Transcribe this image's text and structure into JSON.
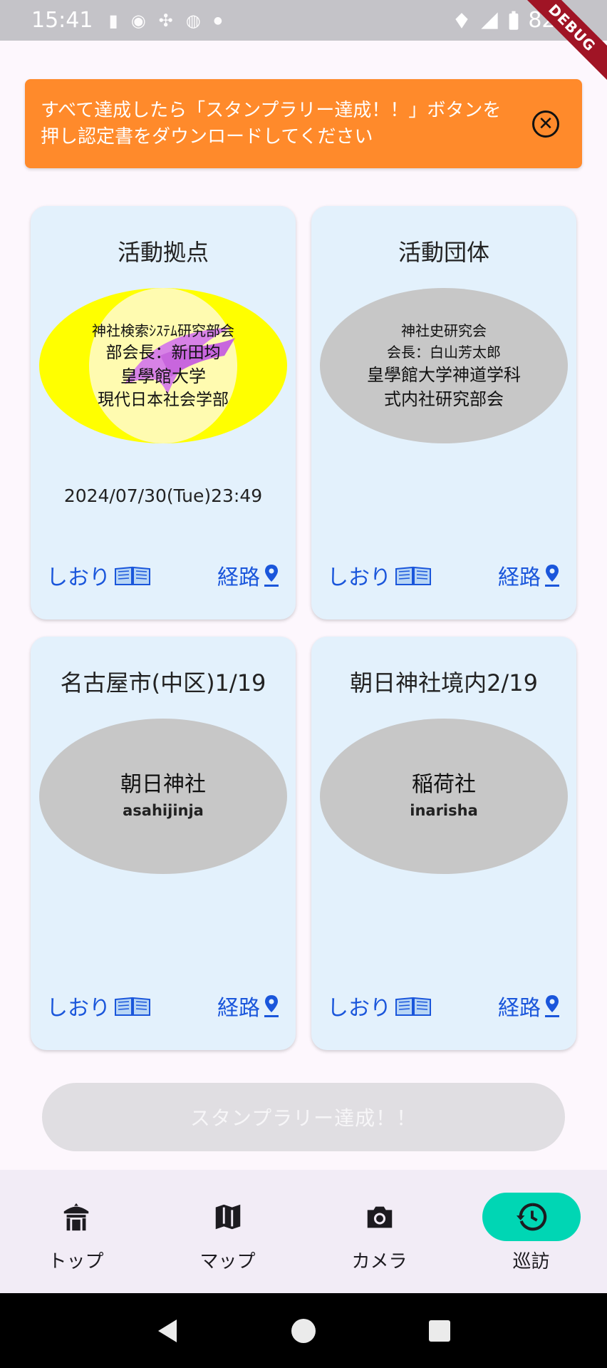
{
  "status_bar": {
    "time": "15:41",
    "battery": "82%",
    "icons_left": [
      "sim-card-icon",
      "messenger-icon",
      "slack-icon",
      "app-icon",
      "dot-icon"
    ],
    "debug_label": "DEBUG"
  },
  "notice": {
    "text": "すべて達成したら「スタンプラリー達成！！」ボタンを押し認定書をダウンロードしてください",
    "color": "#ff8a2b"
  },
  "cards": [
    {
      "title": "活動拠点",
      "earned": true,
      "badge_lines": [
        "神社検索ｼｽﾃﾑ研究部会",
        "部会長：新田均",
        "皇學館大学",
        "現代日本社会学部"
      ],
      "date": "2024/07/30(Tue)23:49",
      "bookmark_label": "しおり",
      "route_label": "経路"
    },
    {
      "title": "活動団体",
      "earned": false,
      "badge_lines": [
        "神社史研究会",
        "会長：白山芳太郎",
        "皇學館大学神道学科",
        "式内社研究部会"
      ],
      "bookmark_label": "しおり",
      "route_label": "経路"
    },
    {
      "title": "名古屋市(中区)1/19",
      "earned": false,
      "badge_name": "朝日神社",
      "badge_roman": "asahijinja",
      "bookmark_label": "しおり",
      "route_label": "経路"
    },
    {
      "title": "朝日神社境内2/19",
      "earned": false,
      "badge_name": "稲荷社",
      "badge_roman": "inarisha",
      "bookmark_label": "しおり",
      "route_label": "経路"
    }
  ],
  "complete_button": {
    "label": "スタンプラリー達成！！",
    "enabled": false
  },
  "bottom_nav": [
    {
      "label": "トップ",
      "icon": "shrine-icon",
      "active": false
    },
    {
      "label": "マップ",
      "icon": "map-icon",
      "active": false
    },
    {
      "label": "カメラ",
      "icon": "camera-icon",
      "active": false
    },
    {
      "label": "巡訪",
      "icon": "history-icon",
      "active": true
    }
  ],
  "colors": {
    "accent": "#00d6b4",
    "link": "#1a56db",
    "card_bg": "#e3f1fc",
    "earned_badge": "#ffff00",
    "unearned_badge": "#c7c7c7"
  }
}
